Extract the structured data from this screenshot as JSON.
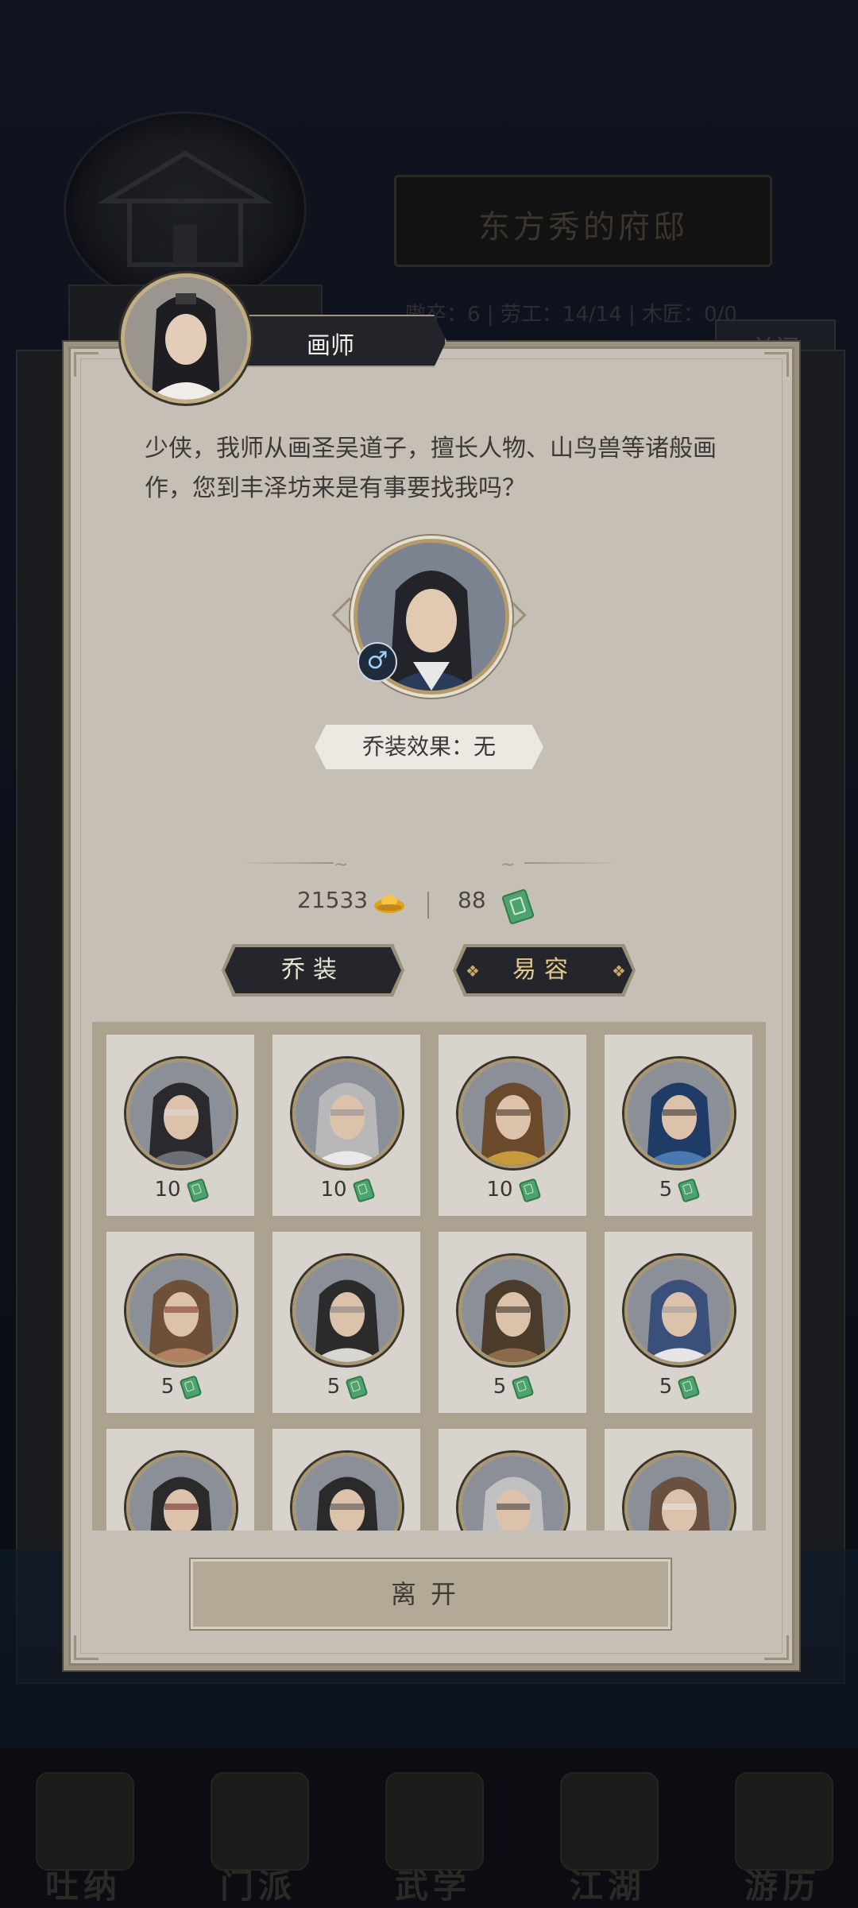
{
  "background": {
    "residence_title": "东方秀的府邸",
    "stats_line": "嗷卒：6 | 劳工：14/14 | 木匠：0/0",
    "close_label": "关闭",
    "nav": [
      "吐纳",
      "门派",
      "武学",
      "江湖",
      "游历"
    ]
  },
  "npc": {
    "name": "画师",
    "avatar_icon": "npc-portrait"
  },
  "dialog": {
    "text": "少侠，我师从画圣吴道子，擅长人物、山鸟兽等诸般画作，您到丰泽坊来是有事要找我吗？"
  },
  "character": {
    "portrait_icon": "male-swordsman-portrait",
    "gender_symbol": "♂",
    "effect_label": "乔装效果：无"
  },
  "currency": {
    "gold": "21533",
    "gold_icon": "gold-ingot-icon",
    "jade": "88",
    "jade_icon": "jade-token-icon"
  },
  "buttons": {
    "disguise": "乔装",
    "change_face": "易容",
    "leave": "离开"
  },
  "disguises": [
    {
      "price": "10",
      "palette": [
        "#2a2a2e",
        "#6c6f77",
        "#e0ddd8"
      ]
    },
    {
      "price": "10",
      "palette": [
        "#b8b8b8",
        "#e9e9e9",
        "#8a8d92"
      ]
    },
    {
      "price": "10",
      "palette": [
        "#6b4a2b",
        "#c89a3c",
        "#3a2a1e"
      ]
    },
    {
      "price": "5",
      "palette": [
        "#1f3c66",
        "#4a78b0",
        "#2a2a2a"
      ]
    },
    {
      "price": "5",
      "palette": [
        "#6e4f3a",
        "#b08060",
        "#7a2a20"
      ]
    },
    {
      "price": "5",
      "palette": [
        "#2b2b2b",
        "#d8d6d2",
        "#808080"
      ]
    },
    {
      "price": "5",
      "palette": [
        "#4a3b2a",
        "#8a6a4a",
        "#2a2420"
      ]
    },
    {
      "price": "5",
      "palette": [
        "#3a4f7a",
        "#e6e6e6",
        "#9a9a9a"
      ]
    },
    {
      "price": "",
      "palette": [
        "#2a2a2a",
        "#d0d0d0",
        "#6a2020"
      ]
    },
    {
      "price": "",
      "palette": [
        "#2a2a2a",
        "#c0a090",
        "#4a4a4a"
      ]
    },
    {
      "price": "",
      "palette": [
        "#c0c0c0",
        "#6a6a6a",
        "#3a3a3a"
      ]
    },
    {
      "price": "",
      "palette": [
        "#6a5040",
        "#b89070",
        "#e8e8e8"
      ]
    }
  ]
}
